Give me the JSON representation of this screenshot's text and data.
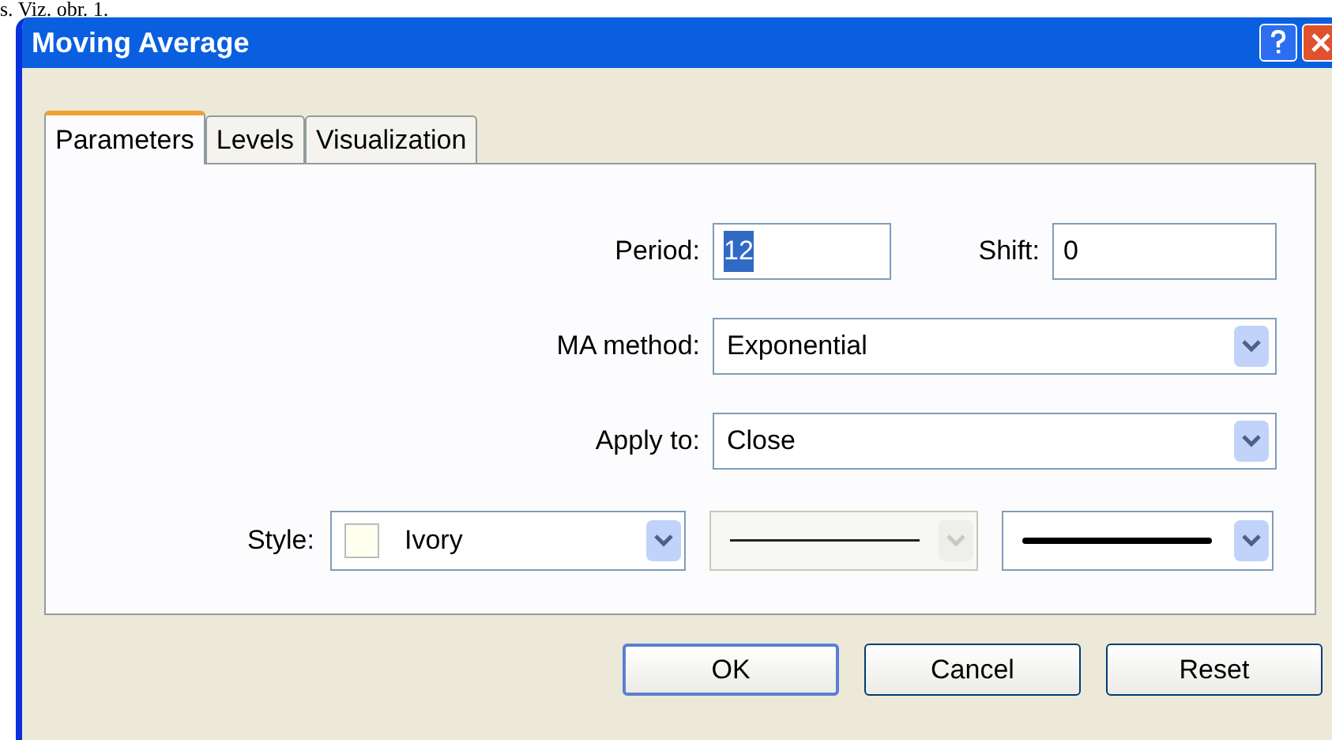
{
  "page_text": "s. Viz. obr. 1.",
  "window": {
    "title": "Moving Average"
  },
  "tabs": [
    {
      "label": "Parameters",
      "selected": true
    },
    {
      "label": "Levels",
      "selected": false
    },
    {
      "label": "Visualization",
      "selected": false
    }
  ],
  "period": {
    "label": "Period:",
    "value": "12",
    "highlighted": true
  },
  "shift": {
    "label": "Shift:",
    "value": "0",
    "highlighted": false
  },
  "ma_method": {
    "label": "MA method:",
    "value": "Exponential"
  },
  "apply_to": {
    "label": "Apply to:",
    "value": "Close"
  },
  "style": {
    "label": "Style:",
    "color_name": "Ivory",
    "color": "#fffff0",
    "line_selects": [
      {
        "kind": "thin",
        "disabled": true
      },
      {
        "kind": "thick",
        "disabled": false
      }
    ]
  },
  "buttons": [
    {
      "label": "OK",
      "default": true
    },
    {
      "label": "Cancel",
      "default": false
    },
    {
      "label": "Reset",
      "default": false
    }
  ]
}
